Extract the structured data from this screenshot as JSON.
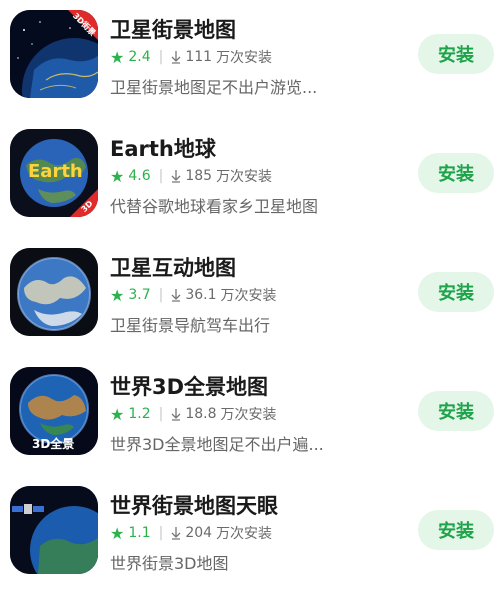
{
  "apps": [
    {
      "name": "卫星街景地图",
      "rating": "2.4",
      "downloads": "111",
      "downloads_unit": "万次安装",
      "desc": "卫星街景地图足不出户游览...",
      "badge": "3D街景",
      "icon": "earth-night-globe-icon",
      "install_label": "安装"
    },
    {
      "name": "Earth地球",
      "rating": "4.6",
      "downloads": "185",
      "downloads_unit": "万次安装",
      "desc": "代替谷歌地球看家乡卫星地图",
      "badge": "3D",
      "icon_text": "Earth",
      "icon": "earth-text-globe-icon",
      "install_label": "安装"
    },
    {
      "name": "卫星互动地图",
      "rating": "3.7",
      "downloads": "36.1",
      "downloads_unit": "万次安装",
      "desc": "卫星街景导航驾车出行",
      "icon": "earth-blue-globe-icon",
      "install_label": "安装"
    },
    {
      "name": "世界3D全景地图",
      "rating": "1.2",
      "downloads": "18.8",
      "downloads_unit": "万次安装",
      "desc": "世界3D全景地图足不出户遍...",
      "icon_text": "3D全景",
      "icon": "earth-3d-globe-icon",
      "install_label": "安装"
    },
    {
      "name": "世界街景地图天眼",
      "rating": "1.1",
      "downloads": "204",
      "downloads_unit": "万次安装",
      "desc": "世界街景3D地图",
      "icon": "satellite-earth-icon",
      "install_label": "安装"
    }
  ],
  "colors": {
    "accent_green": "#2bb24c",
    "button_bg": "#e4f6e8",
    "badge_red": "#e12a2a"
  }
}
